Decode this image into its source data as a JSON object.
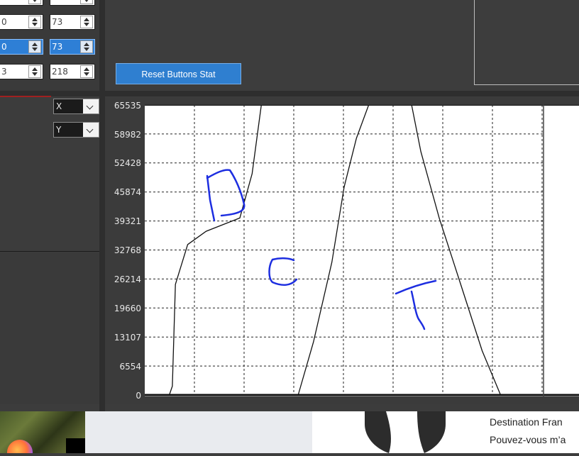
{
  "spinboxes": [
    {
      "row": 1,
      "left": "0",
      "right": "73",
      "selected": false
    },
    {
      "row": 2,
      "left": "0",
      "right": "73",
      "selected": true
    },
    {
      "row": 3,
      "left": "3",
      "right": "218",
      "selected": false
    }
  ],
  "reset_button_label": "Reset Buttons Stat",
  "axis_selectors": {
    "x_label": "X",
    "y_label": "Y"
  },
  "chart_data": {
    "type": "line",
    "y_ticks": [
      "65535",
      "58982",
      "52428",
      "45874",
      "39321",
      "32768",
      "26214",
      "19660",
      "13107",
      "6554",
      "0"
    ],
    "ylim": [
      0,
      65535
    ],
    "grid": true,
    "series": [
      {
        "values": [
          [
            0.08,
            0
          ],
          [
            0.09,
            2000
          ],
          [
            0.1,
            25000
          ],
          [
            0.14,
            34000
          ],
          [
            0.2,
            37000
          ],
          [
            0.31,
            40000
          ],
          [
            0.35,
            50000
          ],
          [
            0.38,
            65535
          ]
        ]
      },
      {
        "values": [
          [
            0.5,
            0
          ],
          [
            0.55,
            12000
          ],
          [
            0.61,
            30000
          ],
          [
            0.65,
            47000
          ],
          [
            0.69,
            58000
          ],
          [
            0.73,
            65535
          ]
        ]
      },
      {
        "values": [
          [
            0.87,
            65535
          ],
          [
            0.9,
            55000
          ],
          [
            0.96,
            40000
          ],
          [
            1.03,
            25000
          ],
          [
            1.1,
            10000
          ],
          [
            1.16,
            0
          ]
        ]
      }
    ]
  },
  "bottom": {
    "text_line1": "Destination Fran",
    "text_line2": "Pouvez-vous m’a"
  }
}
